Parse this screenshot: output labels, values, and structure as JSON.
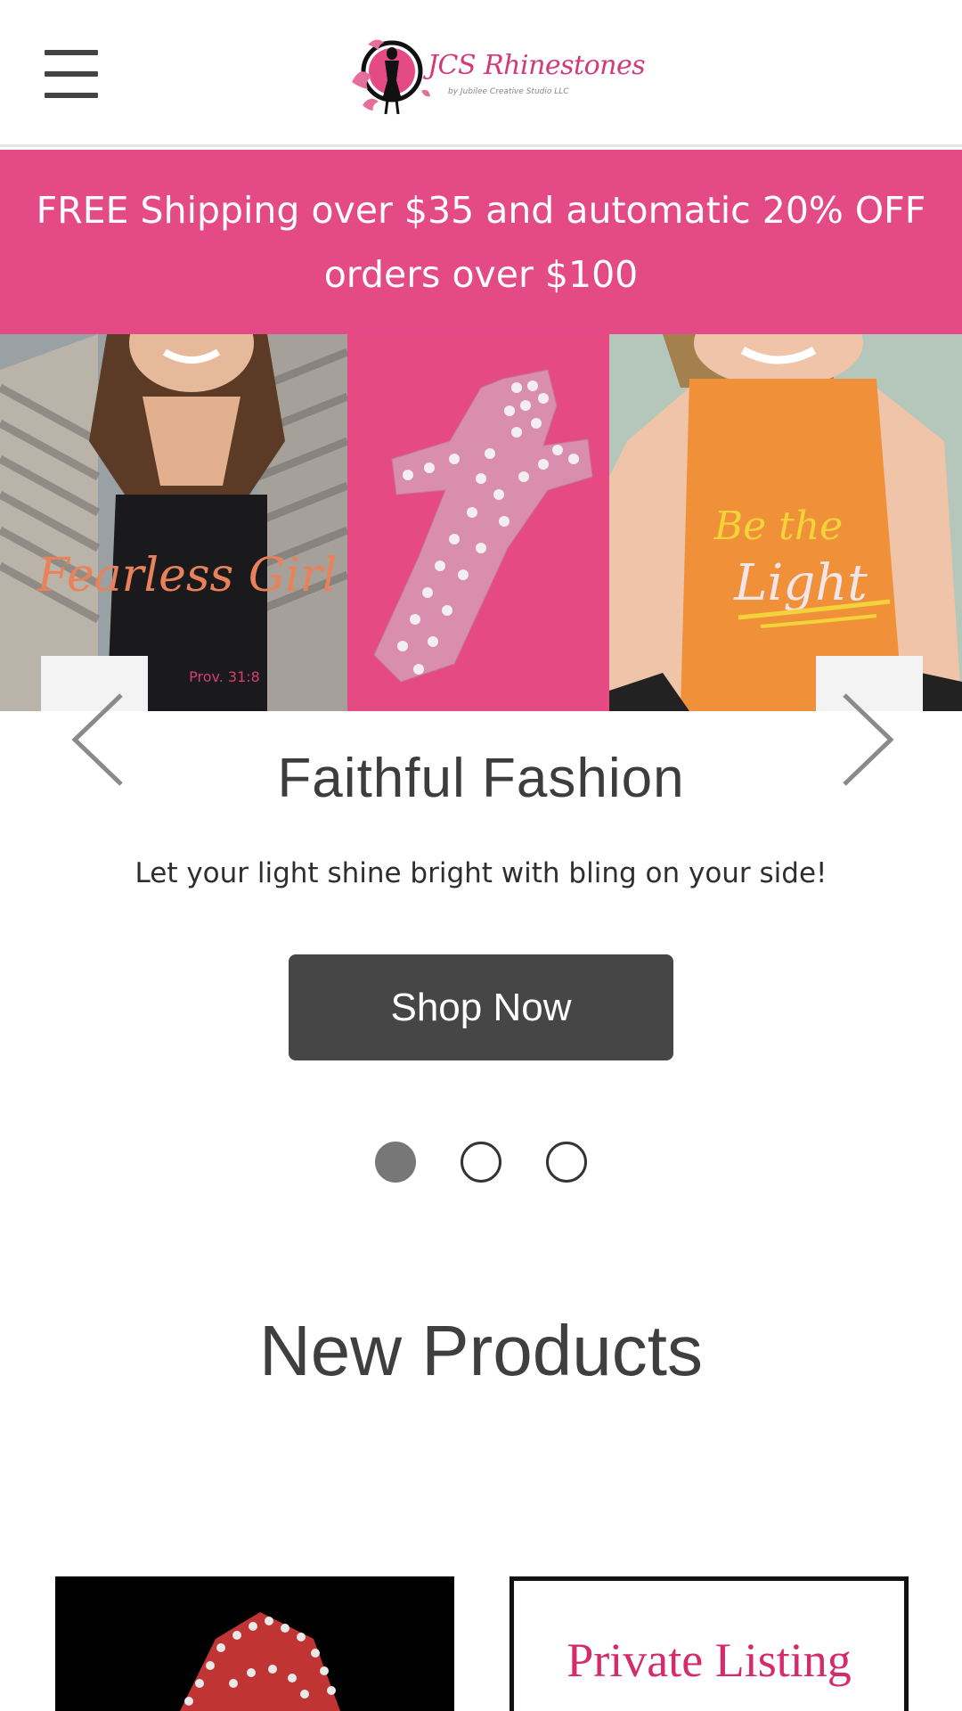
{
  "header": {
    "menu_icon": "hamburger-menu-icon",
    "logo_title": "JCS Rhinestones",
    "logo_subtitle": "by Jubilee Creative Studio LLC"
  },
  "promo": {
    "line1": "FREE Shipping over $35 and automatic 20% OFF",
    "line2": "orders over $100"
  },
  "hero": {
    "image1_text": "Fearless Girl",
    "image1_small": "Prov. 31:8",
    "image3_line1": "Be the",
    "image3_line2": "Light"
  },
  "slide": {
    "title": "Faithful Fashion",
    "subtitle": "Let your light shine bright with bling on your side!",
    "button": "Shop Now",
    "prev_icon": "chevron-left-icon",
    "next_icon": "chevron-right-icon",
    "dots_count": 3,
    "active_dot": 1
  },
  "section": {
    "title": "New Products"
  },
  "products": [
    {
      "label": ""
    },
    {
      "label": "Private Listing"
    }
  ],
  "colors": {
    "brand_pink": "#e44a85",
    "button_dark": "#464646",
    "logo_pink": "#d23a78"
  }
}
